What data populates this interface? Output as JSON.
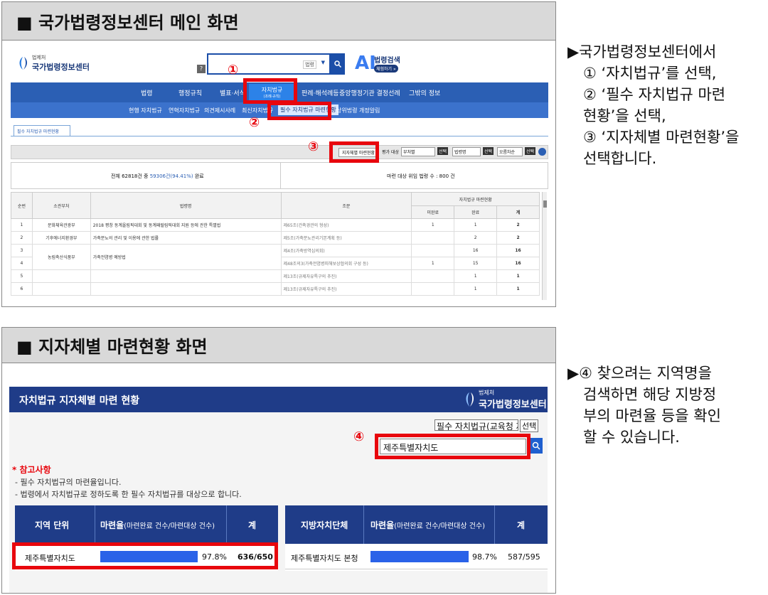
{
  "panel1": {
    "title": "■ 국가법령정보센터 메인 화면",
    "brand_small": "법제처",
    "brand": "국가법령정보센터",
    "help_mark": "?",
    "search_select": "법령",
    "ai_logo": "AI",
    "ai_label": "법령검색",
    "ai_button": "체험하기 »",
    "menu": [
      "법령",
      "행정규칙",
      "별표·서식",
      "자치법규",
      "판례·해석례등",
      "중앙행정기관 결정선례",
      "그밖의 정보"
    ],
    "menu_selected_sub": "(조례·규칙)",
    "submenu": [
      "현행 자치법규",
      "연혁자치법규",
      "의견제시사례",
      "최신자치법규",
      "필수 자치법규 마련현황",
      "상위법령 개정알림"
    ],
    "tab": "필수 자치법규 마련현황",
    "region_button": "지자체별 마련현황",
    "filter_label": "평가 대상",
    "filters": [
      "부처별",
      "법령명",
      "오름차순"
    ],
    "select_btn": "선택",
    "summary_left_prefix": "전체 62818건 중 ",
    "summary_left_value": "59306건(94.41%)",
    "summary_left_suffix": " 완료",
    "summary_right": "마련 대상 위임 법령 수 : 800 건",
    "table_headers": [
      "순번",
      "소관부처",
      "법령명",
      "조문",
      "자치법규 마련현황"
    ],
    "table_subheaders": [
      "미완료",
      "완료",
      "계"
    ],
    "rows": [
      {
        "no": "1",
        "dept": "문화체육관광부",
        "law": "2018 평창 동계올림픽대회 및 동계패럴림픽대회 지원 등에 관한 특별법",
        "clause": "제65조(건축경관의 형성)",
        "incomplete": "1",
        "complete": "1",
        "total": "2"
      },
      {
        "no": "2",
        "dept": "기후에너지환경부",
        "law": "가축분뇨의 관리 및 이용에 관한 법률",
        "clause": "제5조(가축분뇨관리기본계획 등)",
        "incomplete": "",
        "complete": "2",
        "total": "2"
      },
      {
        "no": "3",
        "dept": "",
        "law": "",
        "clause": "제4조(가축방역심의회)",
        "incomplete": "",
        "complete": "16",
        "total": "16"
      },
      {
        "no": "4",
        "dept": "",
        "law": "",
        "clause": "제48조의3(가축전염병피해보상협의회 구성 등)",
        "incomplete": "1",
        "complete": "15",
        "total": "16"
      },
      {
        "no": "5",
        "dept": "",
        "law": "",
        "clause": "제13조(규제자유특구의 추진)",
        "incomplete": "",
        "complete": "1",
        "total": "1"
      },
      {
        "no": "6",
        "dept": "",
        "law": "",
        "clause": "제13조(규제자유특구의 추진)",
        "incomplete": "",
        "complete": "1",
        "total": "1"
      }
    ],
    "merged_dept": "농림축산식품부",
    "merged_law": "가축전염병 예방법",
    "markers": [
      "①",
      "②",
      "③"
    ]
  },
  "panel2": {
    "title": "■ 지자체별 마련현황 화면",
    "header_title": "자치법규 지자체별 마련 현황",
    "brand_small": "법제처",
    "brand": "국가법령정보센터",
    "dropdown": "필수 자치법규(교육청 제",
    "select_btn": "선택",
    "search_value": "제주특별자치도",
    "marker": "④",
    "note_title": "* 참고사항",
    "notes": [
      "- 필수 자치법규의 마련율입니다.",
      "- 법령에서 자치법규로 정하도록 한 필수 자치법규를 대상으로 합니다."
    ],
    "left_headers": [
      "지역 단위",
      "마련율",
      "(마련완료 건수/마련대상 건수)",
      "계"
    ],
    "left_row": {
      "name": "제주특별자치도",
      "rate": "97.8%",
      "count": "636/650",
      "fill": 0.978
    },
    "right_headers": [
      "지방자치단체",
      "마련율",
      "(마련완료 건수/마련대상 건수)",
      "계"
    ],
    "right_row": {
      "name": "제주특별자치도 본청",
      "rate": "98.7%",
      "count": "587/595",
      "fill": 0.987
    }
  },
  "side1": {
    "lines": [
      "▶국가법령정보센터에서",
      "① ‘자치법규’를 선택,",
      "② ‘필수 자치법규 마련",
      "현황’을 선택,",
      "③ ‘지자체별 마련현황’을",
      "선택합니다."
    ]
  },
  "side2": {
    "lines": [
      "▶④ 찾으려는 지역명을",
      "검색하면 해당 지방정",
      "부의 마련율 등을 확인",
      "할 수 있습니다."
    ]
  },
  "colors": {
    "red": "#e8060d",
    "menu_blue": "#2b5fb4",
    "navy": "#1f3c88",
    "bar_blue": "#2a62e8"
  }
}
